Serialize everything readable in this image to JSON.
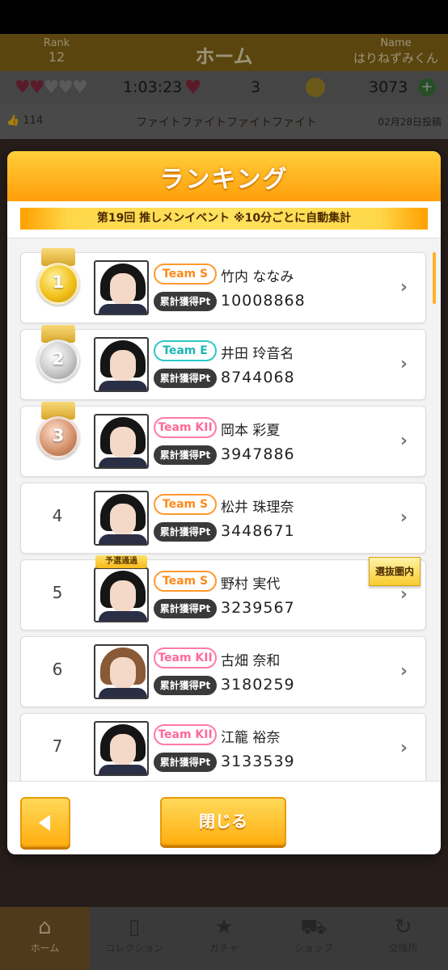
{
  "header": {
    "rank_label": "Rank",
    "rank_value": "12",
    "title": "ホーム",
    "name_label": "Name",
    "name_value": "はりねずみくん"
  },
  "stats": {
    "hearts_filled": 2,
    "hearts_total": 5,
    "timer": "1:03:23",
    "stamina": "3",
    "coins": "3073"
  },
  "news": {
    "likes": "114",
    "text": "ファイトファイトファイトファイト",
    "date": "02月28日投稿"
  },
  "modal": {
    "title": "ランキング",
    "event": "第19回 推しメンイベント ※10分ごとに自動集計",
    "pt_label": "累計獲得Pt",
    "close_label": "閉じる",
    "tag_yosen": "予選通過",
    "tag_senbatsu": "選抜圏内"
  },
  "ranking": [
    {
      "rank": "1",
      "team": "Team S",
      "name": "竹内 ななみ",
      "points": "10008868"
    },
    {
      "rank": "2",
      "team": "Team E",
      "name": "井田 玲音名",
      "points": "8744068"
    },
    {
      "rank": "3",
      "team": "Team KII",
      "name": "岡本 彩夏",
      "points": "3947886"
    },
    {
      "rank": "4",
      "team": "Team S",
      "name": "松井 珠理奈",
      "points": "3448671"
    },
    {
      "rank": "5",
      "team": "Team S",
      "name": "野村 実代",
      "points": "3239567"
    },
    {
      "rank": "6",
      "team": "Team KII",
      "name": "古畑 奈和",
      "points": "3180259"
    },
    {
      "rank": "7",
      "team": "Team KII",
      "name": "江籠 裕奈",
      "points": "3133539"
    }
  ],
  "nav": [
    {
      "label": "ホーム",
      "icon": "home-icon"
    },
    {
      "label": "コレクション",
      "icon": "collection-icon"
    },
    {
      "label": "ガチャ",
      "icon": "gacha-icon"
    },
    {
      "label": "ショップ",
      "icon": "cart-icon"
    },
    {
      "label": "交換所",
      "icon": "exchange-icon"
    }
  ],
  "colors": {
    "accent": "#ffae10",
    "team_s": "#ff8a1a",
    "team_e": "#1ab6b6",
    "team_kii": "#ff6a98"
  }
}
